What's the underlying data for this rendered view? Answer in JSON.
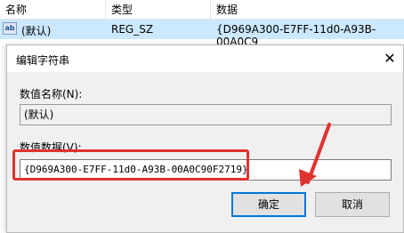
{
  "list": {
    "headers": [
      "名称",
      "类型",
      "数据"
    ],
    "row": {
      "icon": "ab",
      "name": "(默认)",
      "type": "REG_SZ",
      "data": "{D969A300-E7FF-11d0-A93B-00A0C9"
    }
  },
  "dialog": {
    "title": "编辑字符串",
    "close_glyph": "✕",
    "value_name_label": "数值名称(N):",
    "value_name": "(默认)",
    "value_data_label": "数值数据(V):",
    "value_data": "{D969A300-E7FF-11d0-A93B-00A0C90F2719}",
    "ok_label": "确定",
    "cancel_label": "取消"
  },
  "colors": {
    "annotation": "#e0322f",
    "selection": "#cce8ff",
    "focus": "#0078d7"
  }
}
